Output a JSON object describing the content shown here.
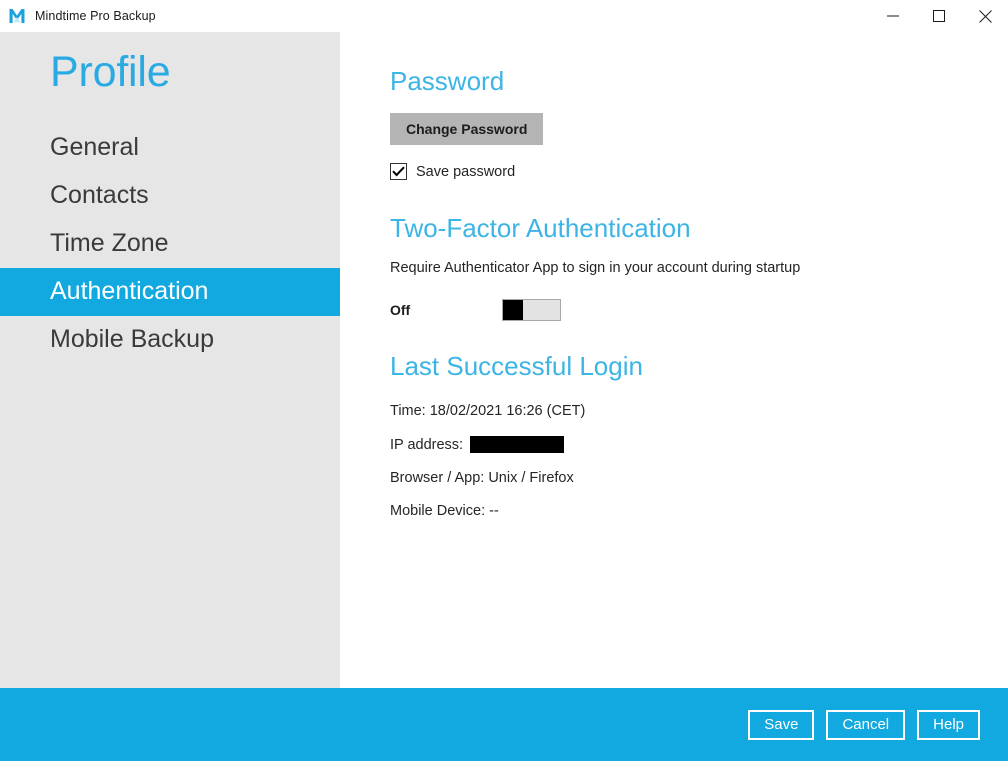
{
  "window": {
    "title": "Mindtime Pro Backup",
    "logo_icon": "mindtime-m-logo",
    "controls": {
      "minimize": "minimize-icon",
      "maximize": "maximize-icon",
      "close": "close-icon"
    }
  },
  "sidebar": {
    "title": "Profile",
    "items": [
      {
        "label": "General",
        "selected": false
      },
      {
        "label": "Contacts",
        "selected": false
      },
      {
        "label": "Time Zone",
        "selected": false
      },
      {
        "label": "Authentication",
        "selected": true
      },
      {
        "label": "Mobile Backup",
        "selected": false
      }
    ]
  },
  "main": {
    "password": {
      "heading": "Password",
      "change_button": "Change Password",
      "save_password_label": "Save password",
      "save_password_checked": true,
      "check_icon": "check-icon"
    },
    "two_factor": {
      "heading": "Two-Factor Authentication",
      "description": "Require Authenticator App to sign in your account during startup",
      "toggle_state_label": "Off",
      "toggle_on": false
    },
    "last_login": {
      "heading": "Last Successful Login",
      "time_label": "Time: 18/02/2021 16:26 (CET)",
      "ip_label": "IP address:",
      "ip_value_redacted": true,
      "browser_label": "Browser / App: Unix / Firefox",
      "mobile_label": "Mobile Device: --"
    }
  },
  "footer": {
    "save_label": "Save",
    "cancel_label": "Cancel",
    "help_label": "Help"
  },
  "colors": {
    "accent_blue": "#12a8e0",
    "heading_blue": "#3cb4e5",
    "sidebar_bg": "#e6e6e6",
    "button_gray": "#b4b4b4"
  }
}
